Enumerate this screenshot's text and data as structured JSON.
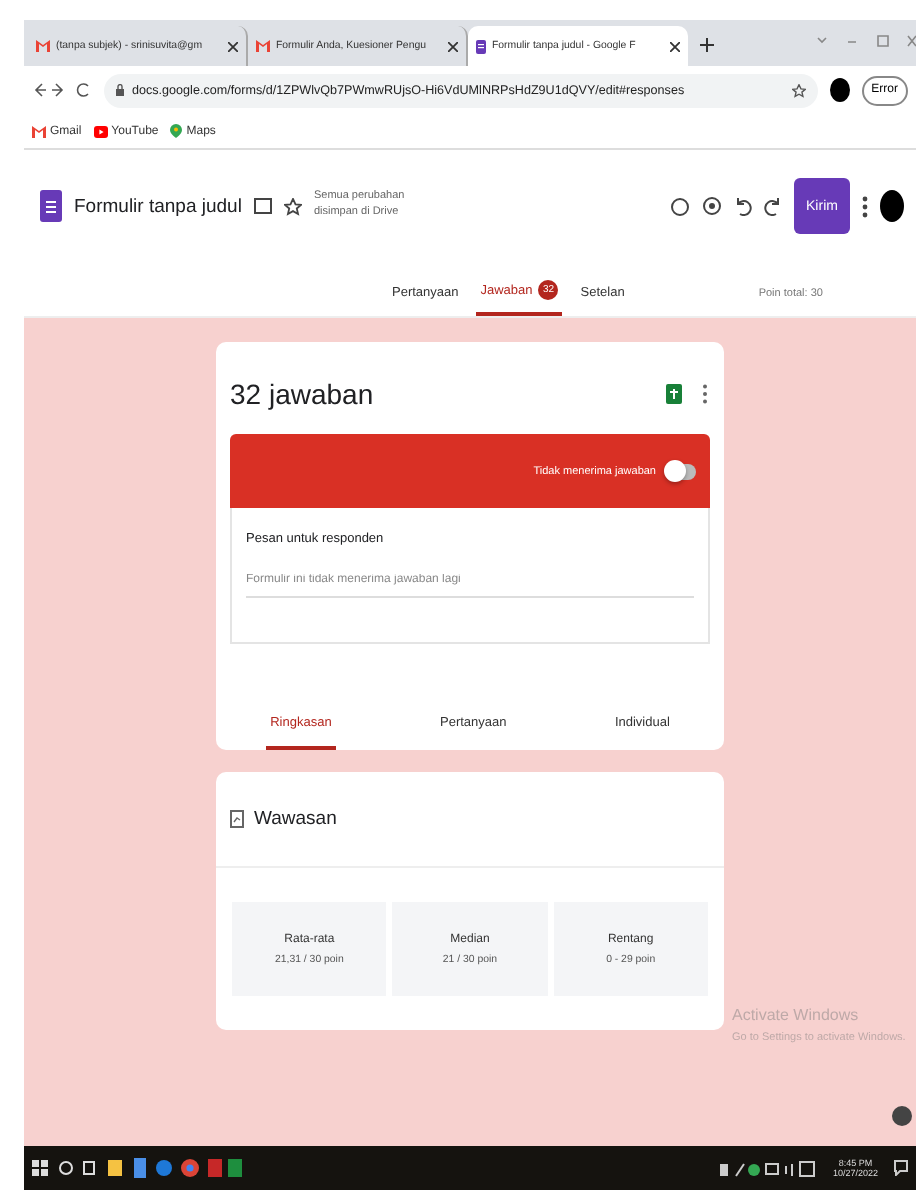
{
  "browser": {
    "tabs": [
      {
        "title": "(tanpa subjek) - srinisuvita@gm",
        "selected": false
      },
      {
        "title": "Formulir Anda, Kuesioner Pengu",
        "selected": false
      },
      {
        "title": "Formulir tanpa judul - Google F",
        "selected": true
      }
    ],
    "address": "docs.google.com/forms/d/1ZPWlvQb7PWmwRUjsO-Hi6VdUMlNRPsHdZ9U1dQVY/edit#responses",
    "error_button": "Error",
    "bookmarks": [
      {
        "label": "Gmail"
      },
      {
        "label": "YouTube"
      },
      {
        "label": "Maps"
      }
    ]
  },
  "form_header": {
    "title": "Formulir tanpa judul",
    "save_status": "Semua perubahan disimpan di Drive",
    "send_button": "Kirim"
  },
  "form_tabs": [
    {
      "label": "Pertanyaan",
      "selected": false
    },
    {
      "label": "Jawaban",
      "selected": true,
      "badge": "32"
    },
    {
      "label": "Setelan",
      "selected": false
    }
  ],
  "total_points": "Poin total: 30",
  "responses": {
    "count_title": "32 jawaban",
    "accepting_label": "Tidak menerima jawaban",
    "accepting": false,
    "message_label": "Pesan untuk responden",
    "message_placeholder": "Formulir ini tidak menerima jawaban lagi",
    "view_tabs": [
      {
        "label": "Ringkasan",
        "selected": true
      },
      {
        "label": "Pertanyaan",
        "selected": false
      },
      {
        "label": "Individual",
        "selected": false
      }
    ]
  },
  "insights": {
    "title": "Wawasan",
    "stats": [
      {
        "label": "Rata-rata",
        "value": "21,31 / 30 poin"
      },
      {
        "label": "Median",
        "value": "21 / 30 poin"
      },
      {
        "label": "Rentang",
        "value": "0 - 29 poin"
      }
    ]
  },
  "activation": {
    "title": "Activate Windows",
    "subtitle": "Go to Settings to activate Windows."
  },
  "taskbar": {
    "time": "8:45 PM",
    "date": "10/27/2022"
  }
}
